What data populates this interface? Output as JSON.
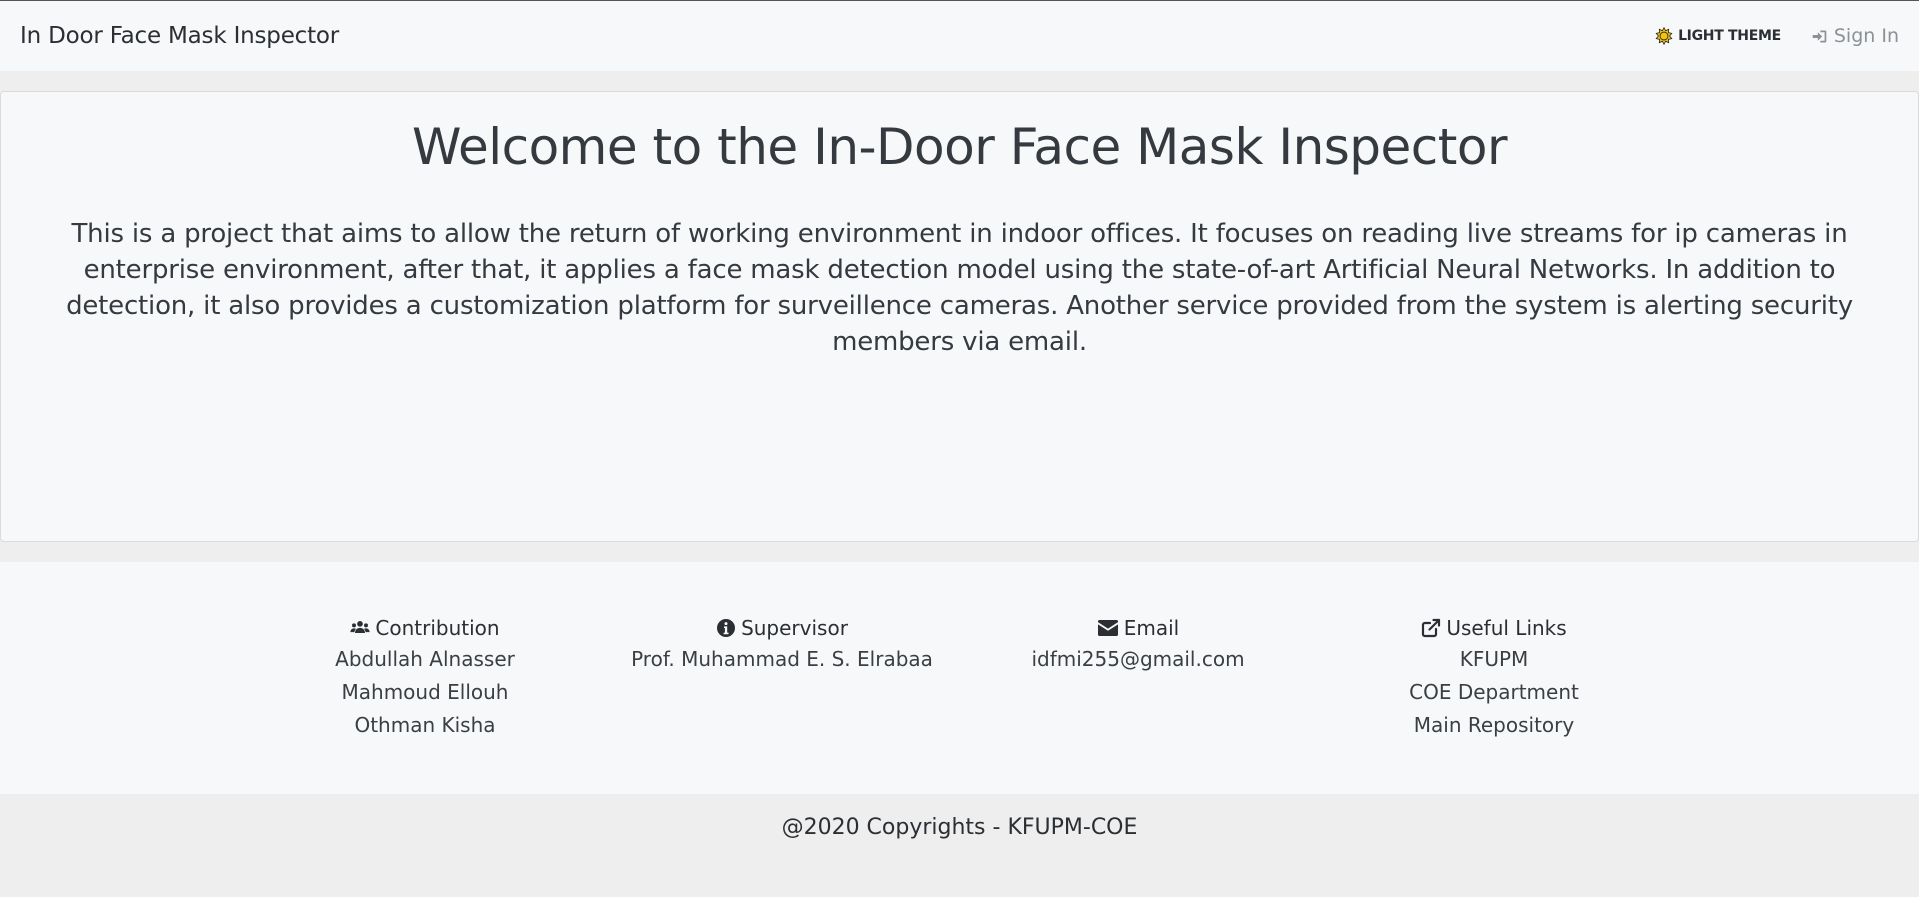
{
  "navbar": {
    "brand": "In Door Face Mask Inspector",
    "theme_label": "LIGHT THEME",
    "signin_label": "Sign In"
  },
  "main": {
    "title": "Welcome to the In-Door Face Mask Inspector",
    "description": "This is a project that aims to allow the return of working environment in indoor offices. It focuses on reading live streams for ip cameras in enterprise environment, after that, it applies a face mask detection model using the state-of-art Artificial Neural Networks. In addition to detection, it also provides a customization platform for surveillence cameras. Another service provided from the system is alerting security members via email."
  },
  "footer": {
    "contribution": {
      "heading": "Contribution",
      "icon": "users-icon",
      "items": [
        "Abdullah Alnasser",
        "Mahmoud Ellouh",
        "Othman Kisha"
      ]
    },
    "supervisor": {
      "heading": "Supervisor",
      "icon": "info-circle-icon",
      "items": [
        "Prof. Muhammad E. S. Elrabaa"
      ]
    },
    "email": {
      "heading": "Email",
      "icon": "envelope-icon",
      "items": [
        "idfmi255@gmail.com"
      ]
    },
    "links": {
      "heading": "Useful Links",
      "icon": "external-link-icon",
      "items": [
        "KFUPM",
        "COE Department",
        "Main Repository"
      ]
    }
  },
  "copyright": "@2020 Copyrights - KFUPM-COE",
  "colors": {
    "page_bg": "#eeeeee",
    "panel_bg": "#f7f8f9",
    "text": "#343a40",
    "muted": "#8b9197",
    "sun_fill": "#f1c40f"
  }
}
